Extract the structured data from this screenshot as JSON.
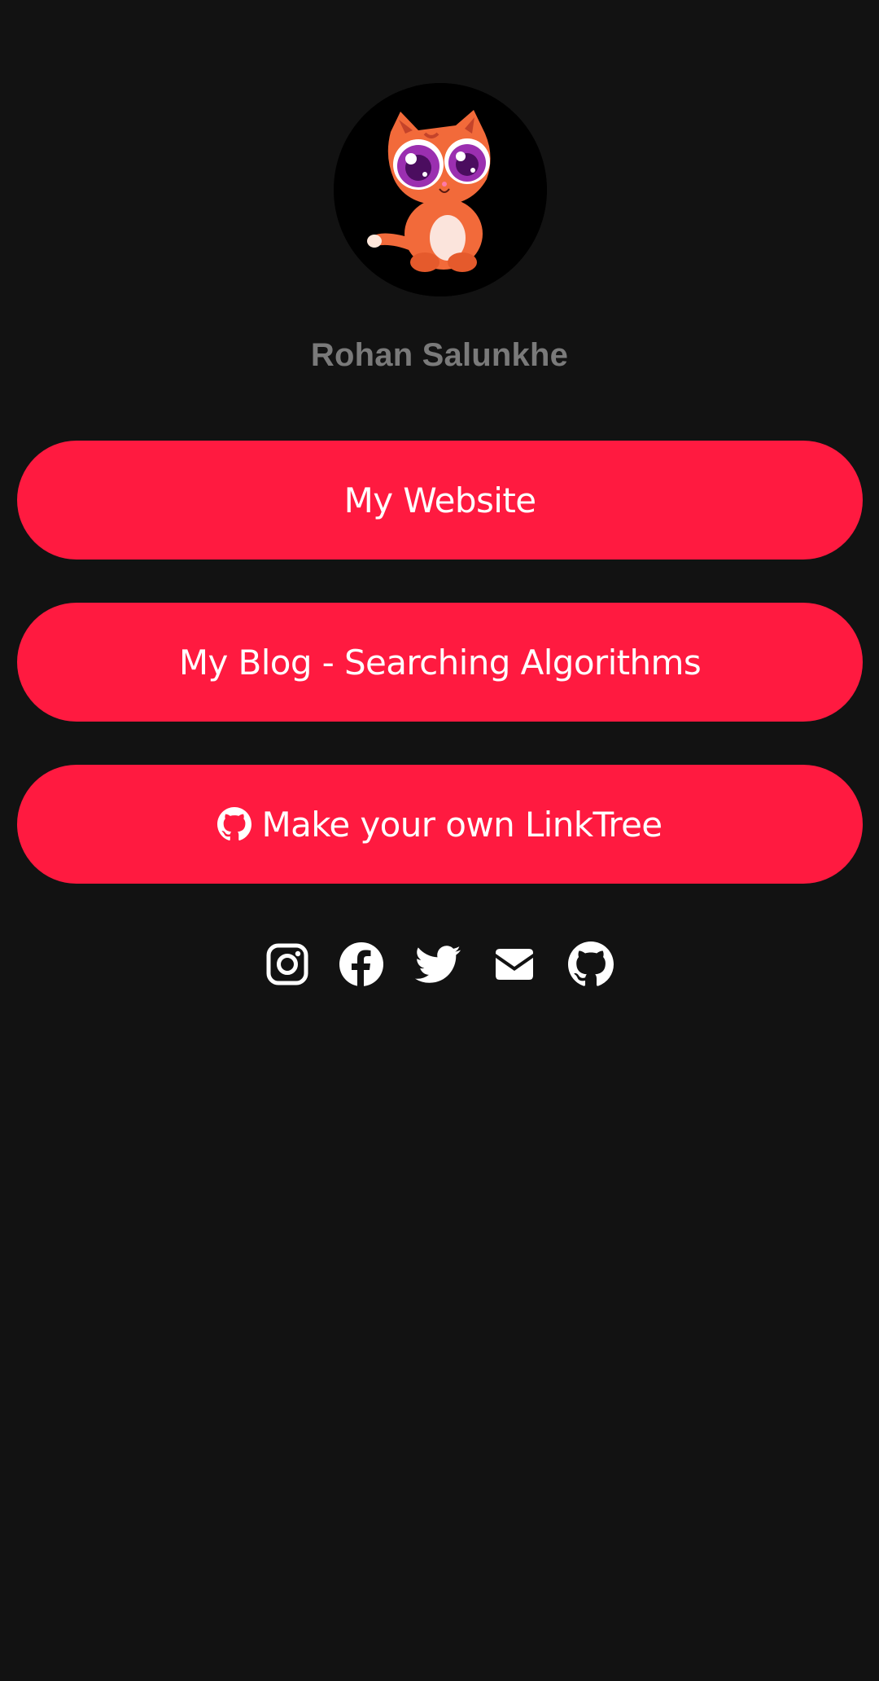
{
  "profile": {
    "name": "Rohan Salunkhe",
    "avatar": "cat-avatar"
  },
  "links": [
    {
      "label": "My Website"
    },
    {
      "label": "My Blog - Searching Algorithms"
    },
    {
      "label": "Make your own LinkTree",
      "icon": "github-icon"
    }
  ],
  "socials": [
    {
      "icon": "instagram-icon"
    },
    {
      "icon": "facebook-icon"
    },
    {
      "icon": "twitter-icon"
    },
    {
      "icon": "email-icon"
    },
    {
      "icon": "github-icon"
    }
  ],
  "colors": {
    "background": "#121212",
    "button": "#ff1a40",
    "button_text": "#ffffff",
    "name_text": "#7a7a7a",
    "icon": "#ffffff"
  }
}
